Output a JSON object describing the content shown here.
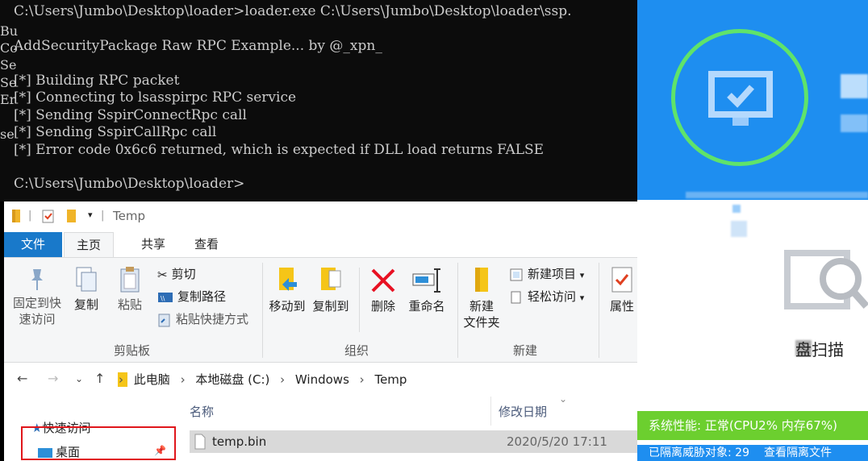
{
  "console": {
    "command": "C:\\Users\\Jumbo\\Desktop\\loader>loader.exe C:\\Users\\Jumbo\\Desktop\\loader\\ssp.",
    "banner": "AddSecurityPackage Raw RPC Example... by @_xpn_",
    "steps": [
      "[*] Building RPC packet",
      "[*] Connecting to lsasspirpc RPC service",
      "[*] Sending SspirConnectRpc call",
      "[*] Sending SspirCallRpc call",
      "[*] Error code 0x6c6 returned, which is expected if DLL load returns FALSE"
    ],
    "prompt": "C:\\Users\\Jumbo\\Desktop\\loader>",
    "left_fragments": [
      "Bu",
      "Co",
      "Se",
      "Se",
      "Er",
      "se"
    ]
  },
  "explorer": {
    "title": "Temp",
    "tabs": {
      "file": "文件",
      "home": "主页",
      "share": "共享",
      "view": "查看"
    },
    "ribbon": {
      "pin": "固定到快\n速访问",
      "copy": "复制",
      "paste": "粘贴",
      "cut": "剪切",
      "copy_path": "复制路径",
      "paste_shortcut": "粘贴快捷方式",
      "clipboard_group": "剪贴板",
      "move_to": "移动到",
      "copy_to": "复制到",
      "delete": "删除",
      "rename": "重命名",
      "organize_group": "组织",
      "new_folder": "新建\n文件夹",
      "new_item": "新建项目",
      "easy_access": "轻松访问",
      "new_group": "新建",
      "properties": "属性"
    },
    "breadcrumbs": [
      "此电脑",
      "本地磁盘 (C:)",
      "Windows",
      "Temp"
    ],
    "nav": {
      "quick_access": "快速访问",
      "desktop": "桌面"
    },
    "columns": {
      "name": "名称",
      "modified": "修改日期"
    },
    "files": [
      {
        "name": "temp.bin",
        "date": "2020/5/20 17:11"
      }
    ]
  },
  "security": {
    "scan_label": "盘扫描",
    "status": "系统性能: 正常(CPU2% 内存67%)",
    "bottom_left": "已隔离威胁对象: 29",
    "bottom_right": "查看隔离文件"
  }
}
